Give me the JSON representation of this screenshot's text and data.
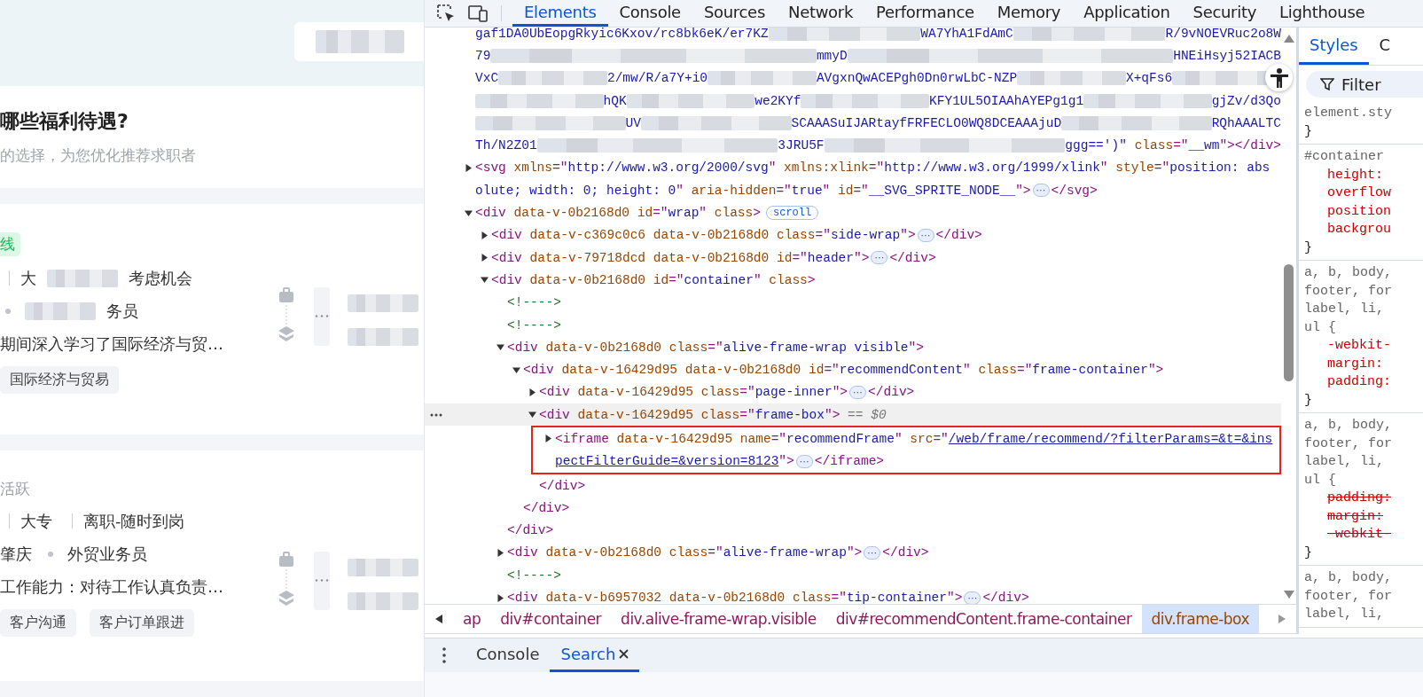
{
  "page": {
    "question": {
      "title": "哪些福利待遇?",
      "subtitle": "的选择，为您优化推荐求职者"
    },
    "candidates": [
      {
        "status": "线",
        "kind": "online",
        "rows": [
          [
            {
              "kind": "sep"
            },
            {
              "kind": "text",
              "text": "大"
            },
            {
              "kind": "blur"
            },
            {
              "kind": "text",
              "text": "考虑机会"
            }
          ],
          [
            {
              "kind": "dot"
            },
            {
              "kind": "blur"
            },
            {
              "kind": "text",
              "text": "务员"
            }
          ]
        ],
        "description": "期间深入学习了国际经济与贸…",
        "tags": [
          "国际经济与贸易"
        ]
      },
      {
        "status": "活跃",
        "kind": "active",
        "rows": [
          [
            {
              "kind": "sep"
            },
            {
              "kind": "text",
              "text": "大专"
            },
            {
              "kind": "sep"
            },
            {
              "kind": "text",
              "text": "离职-随时到岗"
            }
          ],
          [
            {
              "kind": "text",
              "text": "肇庆"
            },
            {
              "kind": "dot"
            },
            {
              "kind": "text",
              "text": "外贸业务员"
            }
          ]
        ],
        "description": "工作能力：对待工作认真负责…",
        "tags": [
          "客户沟通",
          "客户订单跟进"
        ]
      }
    ]
  },
  "devtools": {
    "tabs": [
      {
        "label": "Elements",
        "selected": true
      },
      {
        "label": "Console",
        "selected": false
      },
      {
        "label": "Sources",
        "selected": false
      },
      {
        "label": "Network",
        "selected": false
      },
      {
        "label": "Performance",
        "selected": false
      },
      {
        "label": "Memory",
        "selected": false
      },
      {
        "label": "Application",
        "selected": false
      },
      {
        "label": "Security",
        "selected": false
      },
      {
        "label": "Lighthouse",
        "selected": false
      }
    ],
    "dom_tree": [
      {
        "lines": [
          [
            {
              "kind": "value",
              "text": "gaf1DA0UbEopgRkyic6Kxov/rc8bk6eK/er7KZ"
            },
            {
              "kind": "blur"
            },
            {
              "kind": "value",
              "text": "WA7YhA1FdAmC"
            },
            {
              "kind": "blur"
            },
            {
              "kind": "value",
              "text": "R/9vNOEVRuc2o8W"
            }
          ],
          [
            {
              "kind": "value",
              "text": "79"
            },
            {
              "kind": "blur"
            },
            {
              "kind": "value",
              "text": "mmyD"
            },
            {
              "kind": "blur"
            },
            {
              "kind": "value",
              "text": "HNEiHsyj52IACB"
            }
          ],
          [
            {
              "kind": "value",
              "text": "VxC"
            },
            {
              "kind": "blur"
            },
            {
              "kind": "value",
              "text": "2/mw/R/a7Y+i0"
            },
            {
              "kind": "blur"
            },
            {
              "kind": "value",
              "text": "AVgxnQwACEPgh0Dn0rwLbC-NZP"
            },
            {
              "kind": "blur"
            },
            {
              "kind": "value",
              "text": "X+qFs6"
            },
            {
              "kind": "blur"
            }
          ],
          [
            {
              "kind": "blur"
            },
            {
              "kind": "value",
              "text": "hQK"
            },
            {
              "kind": "blur"
            },
            {
              "kind": "value",
              "text": "we2KYf"
            },
            {
              "kind": "blur"
            },
            {
              "kind": "value",
              "text": "KFY1UL5OIAAhAYEPg1g1"
            },
            {
              "kind": "blur"
            },
            {
              "kind": "value",
              "text": "gjZv/d3Qo"
            }
          ],
          [
            {
              "kind": "blur"
            },
            {
              "kind": "value",
              "text": "UV"
            },
            {
              "kind": "blur"
            },
            {
              "kind": "value",
              "text": "SCAAASuIJARtayfFRFECLO0WQ8DCEAAAjuD"
            },
            {
              "kind": "blur"
            },
            {
              "kind": "value",
              "text": "RQhAAALTC"
            }
          ],
          [
            {
              "kind": "value",
              "text": "Th/N2Z01"
            },
            {
              "kind": "blur"
            },
            {
              "kind": "value",
              "text": "3JRU5F"
            },
            {
              "kind": "blur"
            },
            {
              "kind": "value",
              "text": "ggg==')\""
            },
            {
              "kind": "attr",
              "text": " class"
            },
            {
              "kind": "tag",
              "text": "=\""
            },
            {
              "kind": "value",
              "text": "__wm"
            },
            {
              "kind": "tag",
              "text": "\"></div>"
            }
          ]
        ]
      },
      {
        "expanded": false,
        "lines": [
          [
            {
              "kind": "tag",
              "text": "<svg"
            },
            {
              "kind": "attr",
              "text": " xmlns"
            },
            {
              "kind": "tag",
              "text": "=\""
            },
            {
              "kind": "value",
              "text": "http://www.w3.org/2000/svg"
            },
            {
              "kind": "tag",
              "text": "\""
            },
            {
              "kind": "attr",
              "text": " xmlns:xlink"
            },
            {
              "kind": "tag",
              "text": "=\""
            },
            {
              "kind": "value",
              "text": "http://www.w3.org/1999/xlink"
            },
            {
              "kind": "tag",
              "text": "\""
            },
            {
              "kind": "attr",
              "text": " style"
            },
            {
              "kind": "tag",
              "text": "=\""
            },
            {
              "kind": "value",
              "text": "position: abs"
            }
          ],
          [
            {
              "kind": "value",
              "text": "olute; width: 0; height: 0"
            },
            {
              "kind": "tag",
              "text": "\""
            },
            {
              "kind": "attr",
              "text": " aria-hidden"
            },
            {
              "kind": "tag",
              "text": "=\""
            },
            {
              "kind": "value",
              "text": "true"
            },
            {
              "kind": "tag",
              "text": "\""
            },
            {
              "kind": "attr",
              "text": " id"
            },
            {
              "kind": "tag",
              "text": "=\""
            },
            {
              "kind": "value",
              "text": "__SVG_SPRITE_NODE__"
            },
            {
              "kind": "tag",
              "text": "\">"
            },
            {
              "kind": "ellipsis",
              "text": "⋯"
            },
            {
              "kind": "tag",
              "text": "</svg>"
            }
          ]
        ]
      },
      {
        "expanded": true,
        "lines": [
          [
            {
              "kind": "tag",
              "text": "<div"
            },
            {
              "kind": "attr",
              "text": " data-v-0b2168d0 id"
            },
            {
              "kind": "tag",
              "text": "=\""
            },
            {
              "kind": "value",
              "text": "wrap"
            },
            {
              "kind": "tag",
              "text": "\""
            },
            {
              "kind": "attr",
              "text": " class"
            },
            {
              "kind": "tag",
              "text": ">"
            },
            {
              "kind": "badge",
              "text": "scroll"
            }
          ]
        ],
        "children": [
          {
            "expanded": false,
            "lines": [
              [
                {
                  "kind": "tag",
                  "text": "<div"
                },
                {
                  "kind": "attr",
                  "text": " data-v-c369c0c6 data-v-0b2168d0 class"
                },
                {
                  "kind": "tag",
                  "text": "=\""
                },
                {
                  "kind": "value",
                  "text": "side-wrap"
                },
                {
                  "kind": "tag",
                  "text": "\">"
                },
                {
                  "kind": "ellipsis",
                  "text": "⋯"
                },
                {
                  "kind": "tag",
                  "text": "</div>"
                }
              ]
            ]
          },
          {
            "expanded": false,
            "lines": [
              [
                {
                  "kind": "tag",
                  "text": "<div"
                },
                {
                  "kind": "attr",
                  "text": " data-v-79718dcd data-v-0b2168d0 id"
                },
                {
                  "kind": "tag",
                  "text": "=\""
                },
                {
                  "kind": "value",
                  "text": "header"
                },
                {
                  "kind": "tag",
                  "text": "\">"
                },
                {
                  "kind": "ellipsis",
                  "text": "⋯"
                },
                {
                  "kind": "tag",
                  "text": "</div>"
                }
              ]
            ]
          },
          {
            "expanded": true,
            "lines": [
              [
                {
                  "kind": "tag",
                  "text": "<div"
                },
                {
                  "kind": "attr",
                  "text": " data-v-0b2168d0 id"
                },
                {
                  "kind": "tag",
                  "text": "=\""
                },
                {
                  "kind": "value",
                  "text": "container"
                },
                {
                  "kind": "tag",
                  "text": "\""
                },
                {
                  "kind": "attr",
                  "text": " class"
                },
                {
                  "kind": "tag",
                  "text": ">"
                }
              ]
            ],
            "children": [
              {
                "lines": [
                  [
                    {
                      "kind": "comment",
                      "text": "<!---->"
                    }
                  ]
                ]
              },
              {
                "lines": [
                  [
                    {
                      "kind": "comment",
                      "text": "<!---->"
                    }
                  ]
                ]
              },
              {
                "expanded": true,
                "lines": [
                  [
                    {
                      "kind": "tag",
                      "text": "<div"
                    },
                    {
                      "kind": "attr",
                      "text": " data-v-0b2168d0 class"
                    },
                    {
                      "kind": "tag",
                      "text": "=\""
                    },
                    {
                      "kind": "value",
                      "text": "alive-frame-wrap visible"
                    },
                    {
                      "kind": "tag",
                      "text": "\">"
                    }
                  ]
                ],
                "closing": "</div>",
                "children": [
                  {
                    "expanded": true,
                    "lines": [
                      [
                        {
                          "kind": "tag",
                          "text": "<div"
                        },
                        {
                          "kind": "attr",
                          "text": " data-v-16429d95 data-v-0b2168d0 id"
                        },
                        {
                          "kind": "tag",
                          "text": "=\""
                        },
                        {
                          "kind": "value",
                          "text": "recommendContent"
                        },
                        {
                          "kind": "tag",
                          "text": "\""
                        },
                        {
                          "kind": "attr",
                          "text": " class"
                        },
                        {
                          "kind": "tag",
                          "text": "=\""
                        },
                        {
                          "kind": "value",
                          "text": "frame-container"
                        },
                        {
                          "kind": "tag",
                          "text": "\">"
                        }
                      ]
                    ],
                    "closing": "</div>",
                    "children": [
                      {
                        "expanded": false,
                        "lines": [
                          [
                            {
                              "kind": "tag",
                              "text": "<div"
                            },
                            {
                              "kind": "attr",
                              "text": " data-v-16429d95 class"
                            },
                            {
                              "kind": "tag",
                              "text": "=\""
                            },
                            {
                              "kind": "value",
                              "text": "page-inner"
                            },
                            {
                              "kind": "tag",
                              "text": "\">"
                            },
                            {
                              "kind": "ellipsis",
                              "text": "⋯"
                            },
                            {
                              "kind": "tag",
                              "text": "</div>"
                            }
                          ]
                        ]
                      },
                      {
                        "expanded": true,
                        "selected": true,
                        "lines": [
                          [
                            {
                              "kind": "tag",
                              "text": "<div"
                            },
                            {
                              "kind": "attr",
                              "text": " data-v-16429d95 class"
                            },
                            {
                              "kind": "tag",
                              "text": "=\""
                            },
                            {
                              "kind": "value",
                              "text": "frame-box"
                            },
                            {
                              "kind": "tag",
                              "text": "\">"
                            },
                            {
                              "kind": "hint",
                              "text": " == $0"
                            }
                          ]
                        ],
                        "closing": "</div>",
                        "children": [
                          {
                            "expanded": false,
                            "highlighted": true,
                            "lines": [
                              [
                                {
                                  "kind": "tag",
                                  "text": "<iframe"
                                },
                                {
                                  "kind": "attr",
                                  "text": " data-v-16429d95 name"
                                },
                                {
                                  "kind": "tag",
                                  "text": "=\""
                                },
                                {
                                  "kind": "value",
                                  "text": "recommendFrame"
                                },
                                {
                                  "kind": "tag",
                                  "text": "\""
                                },
                                {
                                  "kind": "attr",
                                  "text": " src"
                                },
                                {
                                  "kind": "tag",
                                  "text": "=\""
                                },
                                {
                                  "kind": "link",
                                  "text": "/web/frame/recommend/?filterParams=&t=&ins"
                                }
                              ],
                              [
                                {
                                  "kind": "link",
                                  "text": "pectFilterGuide=&version=8123"
                                },
                                {
                                  "kind": "tag",
                                  "text": "\">"
                                },
                                {
                                  "kind": "ellipsis",
                                  "text": "⋯"
                                },
                                {
                                  "kind": "tag",
                                  "text": "</iframe>"
                                }
                              ]
                            ]
                          }
                        ]
                      }
                    ]
                  }
                ]
              },
              {
                "expanded": false,
                "lines": [
                  [
                    {
                      "kind": "tag",
                      "text": "<div"
                    },
                    {
                      "kind": "attr",
                      "text": " data-v-0b2168d0 class"
                    },
                    {
                      "kind": "tag",
                      "text": "=\""
                    },
                    {
                      "kind": "value",
                      "text": "alive-frame-wrap"
                    },
                    {
                      "kind": "tag",
                      "text": "\">"
                    },
                    {
                      "kind": "ellipsis",
                      "text": "⋯"
                    },
                    {
                      "kind": "tag",
                      "text": "</div>"
                    }
                  ]
                ]
              },
              {
                "lines": [
                  [
                    {
                      "kind": "comment",
                      "text": "<!---->"
                    }
                  ]
                ]
              },
              {
                "expanded": false,
                "lines": [
                  [
                    {
                      "kind": "tag",
                      "text": "<div"
                    },
                    {
                      "kind": "attr",
                      "text": " data-v-b6957032 data-v-0b2168d0 class"
                    },
                    {
                      "kind": "tag",
                      "text": "=\""
                    },
                    {
                      "kind": "value",
                      "text": "tip-container"
                    },
                    {
                      "kind": "tag",
                      "text": "\">"
                    },
                    {
                      "kind": "ellipsis",
                      "text": "⋯"
                    },
                    {
                      "kind": "tag",
                      "text": "</div>"
                    }
                  ]
                ]
              }
            ]
          }
        ]
      }
    ],
    "breadcrumbs": [
      {
        "text": "ap",
        "selected": false
      },
      {
        "text": "div#container",
        "selected": false
      },
      {
        "text": "div.alive-frame-wrap.visible",
        "selected": false
      },
      {
        "text": "div#recommendContent.frame-container",
        "selected": false
      },
      {
        "text": "div.frame-box",
        "selected": true
      }
    ],
    "drawer_tabs": [
      {
        "label": "Console",
        "selected": false,
        "closable": false
      },
      {
        "label": "Search",
        "selected": true,
        "closable": true
      }
    ],
    "styles": {
      "tabs": [
        {
          "label": "Styles",
          "selected": true
        },
        {
          "label": "C",
          "selected": false
        }
      ],
      "filter": {
        "placeholder": "Filter"
      },
      "rules": [
        {
          "selector": [
            "element.sty"
          ],
          "close": "}"
        },
        {
          "selector": [
            "#container"
          ],
          "props": [
            {
              "text": "height:",
              "struck": false
            },
            {
              "text": "overflow",
              "struck": false
            },
            {
              "text": "position",
              "struck": false
            },
            {
              "text": "backgrou",
              "struck": false
            }
          ],
          "close": "}"
        },
        {
          "selector": [
            "a, b, body,",
            "footer, for",
            "label, li,",
            "ul {"
          ],
          "props": [
            {
              "text": "-webkit-",
              "struck": false
            },
            {
              "text": "margin:",
              "struck": false
            },
            {
              "text": "padding:",
              "struck": false
            }
          ],
          "close": "}"
        },
        {
          "selector": [
            "a, b, body,",
            "footer, for",
            "label, li,",
            "ul {"
          ],
          "props": [
            {
              "text": "padding:",
              "struck": true
            },
            {
              "text": "margin:",
              "struck": true
            },
            {
              "text": "-webkit-",
              "struck": true
            }
          ],
          "close": "}"
        },
        {
          "selector": [
            "a, b, body,",
            "footer, for",
            "label, li,"
          ]
        }
      ]
    }
  }
}
